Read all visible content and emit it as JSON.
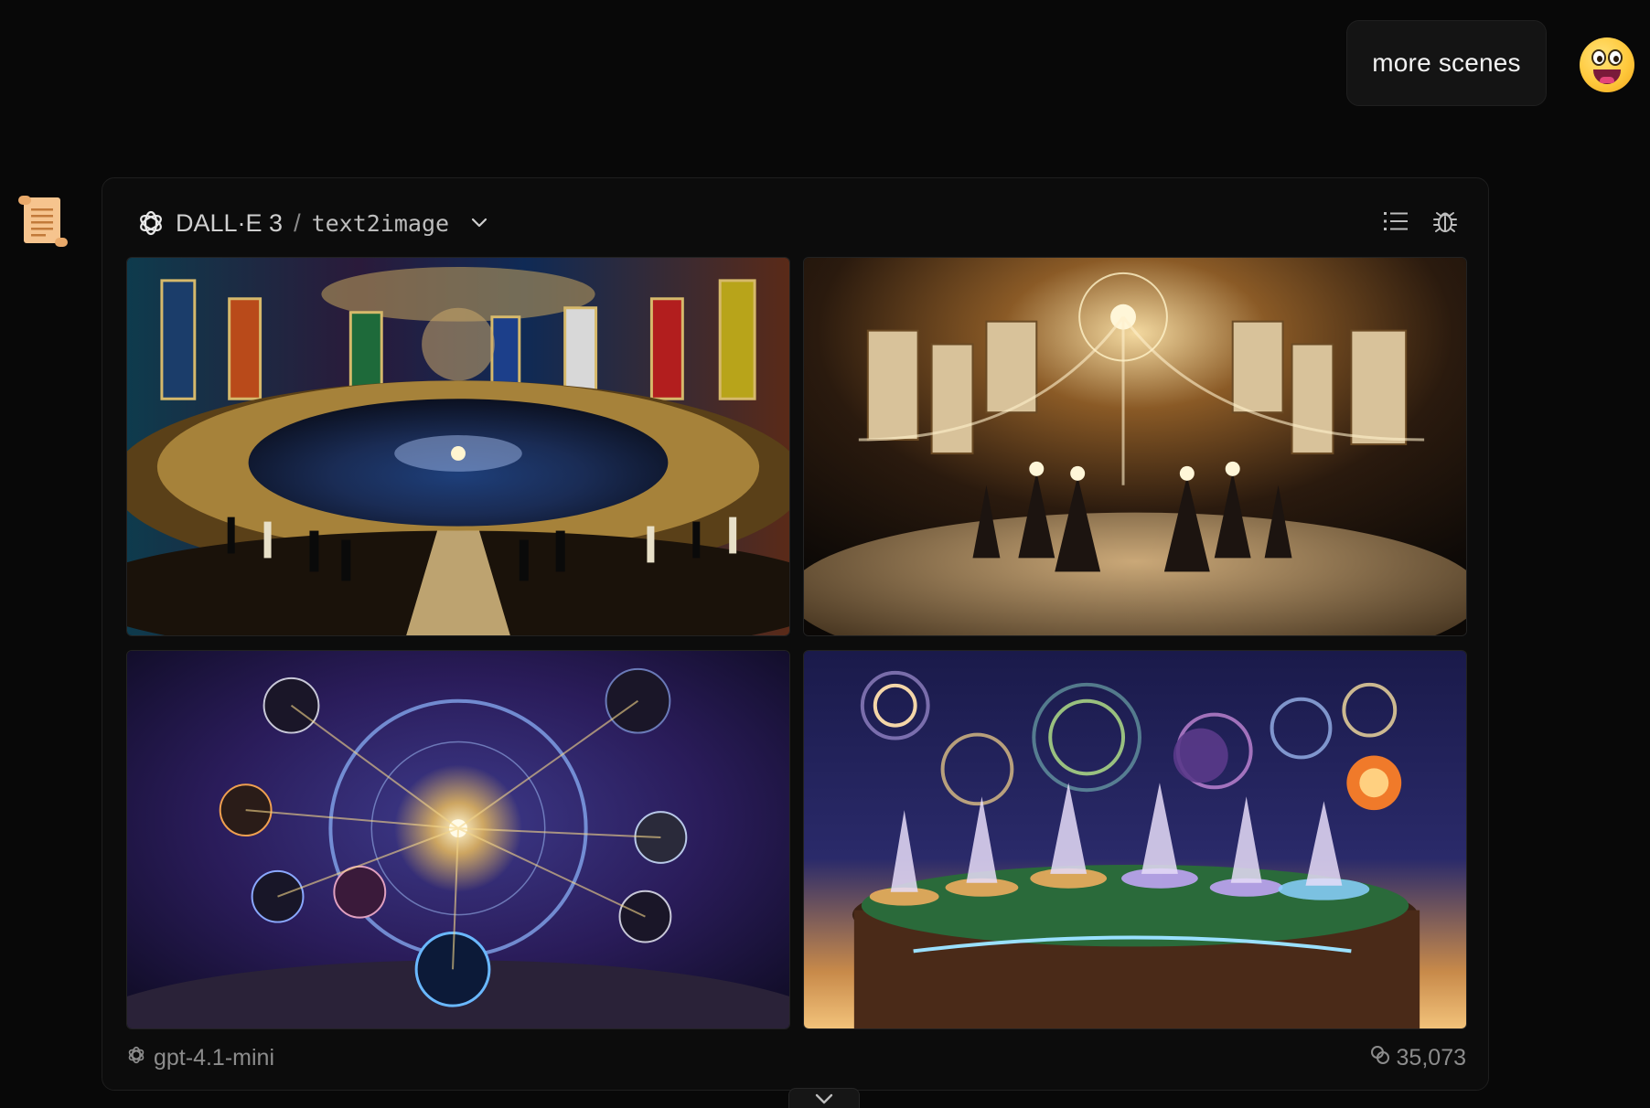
{
  "user_message": {
    "text": "more scenes"
  },
  "assistant": {
    "avatar_icon": "scroll-icon"
  },
  "card": {
    "header": {
      "provider_icon": "openai-logo-icon",
      "model": "DALL·E 3",
      "separator": "/",
      "task": "text2image",
      "dropdown_icon": "chevron-down-icon",
      "actions": [
        {
          "icon": "list-icon"
        },
        {
          "icon": "bug-icon"
        }
      ]
    },
    "images": [
      {
        "name": "cosmic-amphitheater-image"
      },
      {
        "name": "scroll-banners-ritual-image"
      },
      {
        "name": "celestial-spheres-image"
      },
      {
        "name": "galaxy-plateau-figures-image"
      }
    ],
    "footer": {
      "model_icon": "openai-logo-icon",
      "model": "gpt-4.1-mini",
      "token_icon": "tokens-icon",
      "tokens": "35,073"
    }
  },
  "colors": {
    "background": "#080808",
    "card": "#0c0c0c",
    "bubble": "#141414",
    "muted_text": "#8c8c8c"
  }
}
